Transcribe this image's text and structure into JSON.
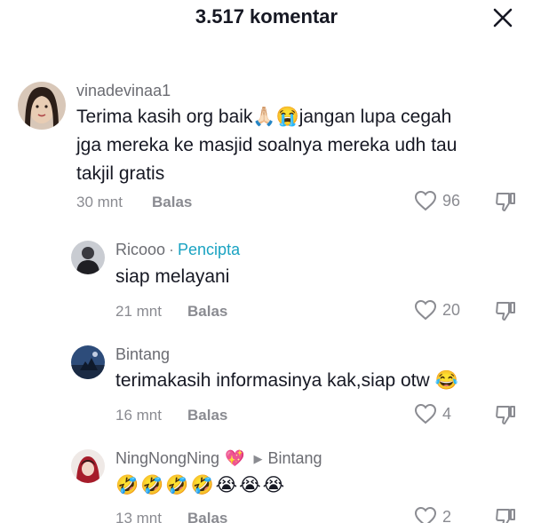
{
  "header": {
    "title": "3.517 komentar"
  },
  "comments": [
    {
      "username": "vinadevinaa1",
      "text_line1": "Terima kasih org baik🙏🏻😭jangan lupa cegah",
      "text_line2": "jga mereka ke masjid soalnya mereka udh tau",
      "text_line3": "takjil gratis",
      "time": "30 mnt",
      "reply_label": "Balas",
      "likes": "96"
    },
    {
      "username": "Ricooo",
      "creator_sep": "·",
      "creator_label": "Pencipta",
      "text": "siap melayani",
      "time": "21 mnt",
      "reply_label": "Balas",
      "likes": "20"
    },
    {
      "username": "Bintang",
      "text": "terimakasih informasinya kak,siap otw 😂",
      "time": "16 mnt",
      "reply_label": "Balas",
      "likes": "4"
    },
    {
      "username": "NingNongNing",
      "heart_emoji": "💖",
      "reply_arrow": "▶",
      "reply_to": "Bintang",
      "text": "🤣🤣🤣🤣😭😭😭",
      "time": "13 mnt",
      "reply_label": "Balas",
      "likes": "2"
    }
  ],
  "colors": {
    "accent": "#1aa3c2",
    "muted": "#8a8b91",
    "text": "#161823"
  },
  "icons": {
    "close": "close-icon",
    "like": "heart-outline-icon",
    "dislike": "thumbs-down-icon"
  }
}
